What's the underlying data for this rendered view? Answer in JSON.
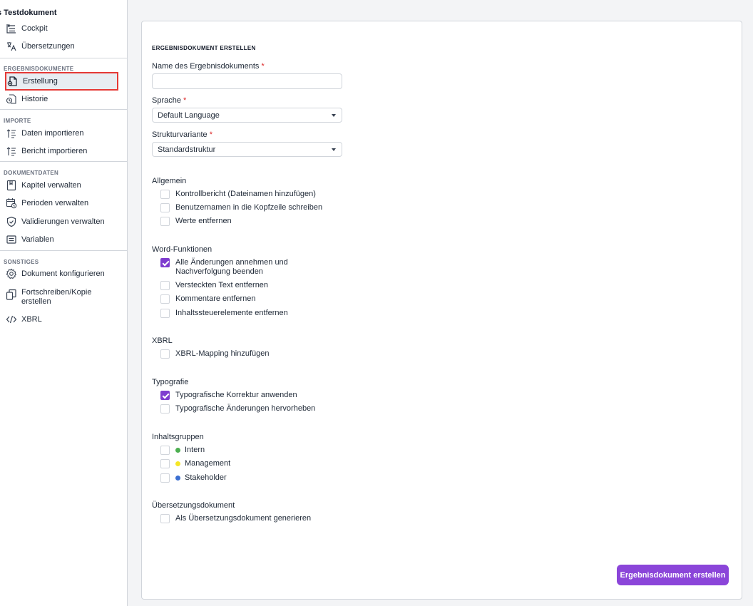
{
  "sidebar": {
    "title": "s Testdokument",
    "top_items": [
      {
        "label": "Cockpit",
        "icon": "cockpit-icon"
      },
      {
        "label": "Übersetzungen",
        "icon": "translate-icon"
      }
    ],
    "sections": [
      {
        "title": "ERGEBNISDOKUMENTE",
        "items": [
          {
            "label": "Erstellung",
            "icon": "document-create-icon",
            "active": true
          },
          {
            "label": "Historie",
            "icon": "history-icon"
          }
        ]
      },
      {
        "title": "IMPORTE",
        "items": [
          {
            "label": "Daten importieren",
            "icon": "import-icon"
          },
          {
            "label": "Bericht importieren",
            "icon": "import-icon"
          }
        ]
      },
      {
        "title": "DOKUMENTDATEN",
        "items": [
          {
            "label": "Kapitel verwalten",
            "icon": "book-icon"
          },
          {
            "label": "Perioden verwalten",
            "icon": "calendar-clock-icon"
          },
          {
            "label": "Validierungen verwalten",
            "icon": "shield-check-icon"
          },
          {
            "label": "Variablen",
            "icon": "variables-icon"
          }
        ]
      },
      {
        "title": "SONSTIGES",
        "items": [
          {
            "label": "Dokument konfigurieren",
            "icon": "gear-icon"
          },
          {
            "label": "Fortschreiben/Kopie erstellen",
            "icon": "copy-icon"
          },
          {
            "label": "XBRL",
            "icon": "code-icon"
          }
        ]
      }
    ]
  },
  "form": {
    "title": "ERGEBNISDOKUMENT ERSTELLEN",
    "name_label": "Name des Ergebnisdokuments",
    "name_value": "",
    "required_mark": "*",
    "language_label": "Sprache",
    "language_value": "Default Language",
    "structure_label": "Strukturvariante",
    "structure_value": "Standardstruktur",
    "groups": [
      {
        "title": "Allgemein",
        "options": [
          {
            "label": "Kontrollbericht (Dateinamen hinzufügen)",
            "checked": false
          },
          {
            "label": "Benutzernamen in die Kopfzeile schreiben",
            "checked": false
          },
          {
            "label": "Werte entfernen",
            "checked": false
          }
        ]
      },
      {
        "title": "Word-Funktionen",
        "options": [
          {
            "label": "Alle Änderungen annehmen und Nachverfolgung beenden",
            "checked": true
          },
          {
            "label": "Versteckten Text entfernen",
            "checked": false
          },
          {
            "label": "Kommentare entfernen",
            "checked": false
          },
          {
            "label": "Inhaltssteuerelemente entfernen",
            "checked": false
          }
        ]
      },
      {
        "title": "XBRL",
        "options": [
          {
            "label": "XBRL-Mapping hinzufügen",
            "checked": false
          }
        ]
      },
      {
        "title": "Typografie",
        "options": [
          {
            "label": "Typografische Korrektur anwenden",
            "checked": true
          },
          {
            "label": "Typografische Änderungen hervorheben",
            "checked": false
          }
        ]
      },
      {
        "title": "Inhaltsgruppen",
        "options": [
          {
            "label": "Intern",
            "checked": false,
            "color": "#4caf50"
          },
          {
            "label": "Management",
            "checked": false,
            "color": "#f5e625"
          },
          {
            "label": "Stakeholder",
            "checked": false,
            "color": "#3b6fd1"
          }
        ]
      },
      {
        "title": "Übersetzungsdokument",
        "options": [
          {
            "label": "Als Übersetzungsdokument generieren",
            "checked": false
          }
        ]
      }
    ],
    "submit_label": "Ergebnisdokument erstellen"
  }
}
